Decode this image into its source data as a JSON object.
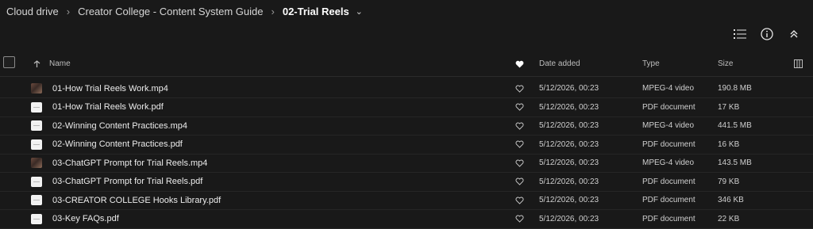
{
  "breadcrumb": {
    "items": [
      "Cloud drive",
      "Creator College - Content System Guide",
      "02-Trial Reels"
    ],
    "separator": "›",
    "caret": "⌄"
  },
  "toolbar": {
    "list_icon": "list-icon",
    "info_icon": "info-icon",
    "collapse_icon": "double-chevron-up-icon"
  },
  "table": {
    "columns": {
      "name": "Name",
      "date_added": "Date added",
      "type": "Type",
      "size": "Size"
    },
    "rows": [
      {
        "name": "01-How Trial Reels Work.mp4",
        "date": "5/12/2026, 00:23",
        "type": "MPEG-4 video",
        "size": "190.8 MB",
        "thumb": "video"
      },
      {
        "name": "01-How Trial Reels Work.pdf",
        "date": "5/12/2026, 00:23",
        "type": "PDF document",
        "size": "17 KB",
        "thumb": "pdf"
      },
      {
        "name": "02-Winning Content Practices.mp4",
        "date": "5/12/2026, 00:23",
        "type": "MPEG-4 video",
        "size": "441.5 MB",
        "thumb": "pdf"
      },
      {
        "name": "02-Winning Content Practices.pdf",
        "date": "5/12/2026, 00:23",
        "type": "PDF document",
        "size": "16 KB",
        "thumb": "pdf"
      },
      {
        "name": "03-ChatGPT Prompt for Trial Reels.mp4",
        "date": "5/12/2026, 00:23",
        "type": "MPEG-4 video",
        "size": "143.5 MB",
        "thumb": "video"
      },
      {
        "name": "03-ChatGPT Prompt for Trial Reels.pdf",
        "date": "5/12/2026, 00:23",
        "type": "PDF document",
        "size": "79 KB",
        "thumb": "pdf"
      },
      {
        "name": "03-CREATOR COLLEGE Hooks Library.pdf",
        "date": "5/12/2026, 00:23",
        "type": "PDF document",
        "size": "346 KB",
        "thumb": "pdf"
      },
      {
        "name": "03-Key FAQs.pdf",
        "date": "5/12/2026, 00:23",
        "type": "PDF document",
        "size": "22 KB",
        "thumb": "pdf"
      }
    ]
  }
}
